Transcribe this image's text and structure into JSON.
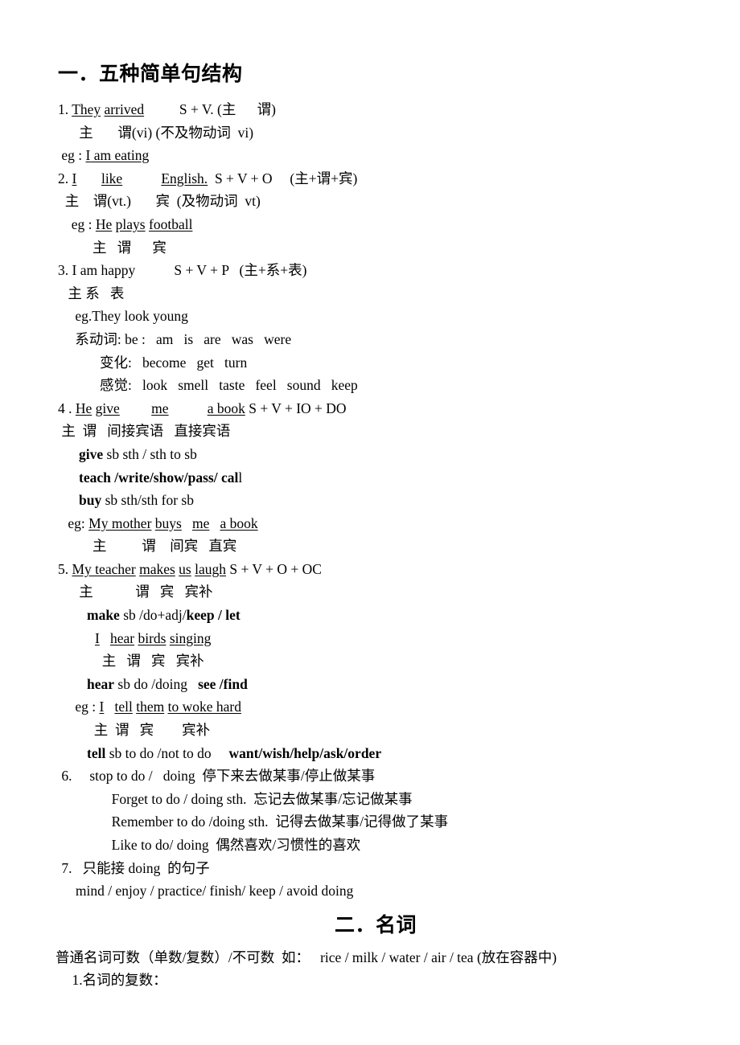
{
  "document": {
    "section1": {
      "heading": "一．五种简单句结构",
      "items": {
        "n1": {
          "num": "1. ",
          "subject": "They",
          "verb": "arrived",
          "gap1": "          ",
          "formula": "S + V. (主      谓)",
          "labels": "      主       谓(vi) (不及物动词  vi)",
          "eg_prefix": " eg : ",
          "eg_a": "I",
          "eg_b": " am eating"
        },
        "n2": {
          "num": "2. ",
          "subject": "I",
          "gap_a": "       ",
          "verb": "like",
          "gap_b": "           ",
          "object": "English.",
          "formula": "  S + V + O     (主+谓+宾)",
          "labels": "  主    谓(vt.)       宾  (及物动词  vt)",
          "eg_prefix": "  eg : ",
          "eg_a": "He",
          "eg_gap": " ",
          "eg_b": "plays",
          "eg_gap2": " ",
          "eg_c": "football",
          "eg_labels": "        主   谓      宾"
        },
        "n3": {
          "line1": "3. I am happy           S + V + P   (主+系+表)",
          "line2": " 主 系   表",
          "line3": " eg.They look young",
          "line4": " 系动词: be :   am   is   are   was   were",
          "line5": "        变化:   become   get   turn",
          "line6": "        感觉:   look   smell   taste   feel   sound   keep"
        },
        "n4": {
          "num": "4 . ",
          "subject": "He",
          "gap_a": " ",
          "verb": "give",
          "gap_b": "         ",
          "io": "me",
          "gap_c": "           ",
          "do": "a book",
          "formula": " S + V + IO + DO",
          "labels": " 主  谓   间接宾语   直接宾语",
          "v1_bold": "give",
          "v1_rest": " sb sth / sth to sb",
          "v2_bold": "teach /write/show/pass/ cal",
          "v2_rest": "l",
          "v3_bold": "buy",
          "v3_rest": " sb sth/sth for sb",
          "eg_prefix": " eg: ",
          "eg_a": "My mother",
          "eg_gap": " ",
          "eg_b": "buys",
          "eg_gap2": "   ",
          "eg_c": "me",
          "eg_gap3": "   ",
          "eg_d": "a book",
          "eg_labels": "        主          谓    间宾   直宾"
        },
        "n5": {
          "num": "5. ",
          "subject": "My teacher",
          "gap_a": " ",
          "verb": "makes",
          "gap_b": " ",
          "object": "us",
          "gap_c": " ",
          "oc": "laugh",
          "formula": " S + V + O + OC",
          "labels": "      主            谓   宾   宾补",
          "m1_b1": "make",
          "m1_r1": " sb /do+adj/",
          "m1_b2": "keep / let",
          "ex_a": "I",
          "ex_gap": "   ",
          "ex_b": "hear",
          "ex_gap2": " ",
          "ex_c": "birds",
          "ex_gap3": " ",
          "ex_d": "singing",
          "ex_labels": "  主   谓   宾   宾补",
          "h_b1": "hear",
          "h_r1": " sb do /doing   ",
          "h_b2": "see /find",
          "eg_prefix": " eg : ",
          "eg_a": "I",
          "eg_gap": "   ",
          "eg_b": "tell",
          "eg_gap2": " ",
          "eg_c": "them",
          "eg_gap3": " ",
          "eg_d": "to woke hard",
          "eg_labels": "  主  谓   宾        宾补",
          "t_b1": "tell",
          "t_r1": " sb to do /not to do     ",
          "t_b2": "want/wish/help/ask/order"
        },
        "n6": {
          "line1": " 6.     stop to do /   doing  停下来去做某事/停止做某事",
          "line2": "       Forget to do / doing sth.  忘记去做某事/忘记做某事",
          "line3": "       Remember to do /doing sth.  记得去做某事/记得做了某事",
          "line4": "       Like to do/ doing  偶然喜欢/习惯性的喜欢"
        },
        "n7": {
          "line1": " 7.   只能接 doing  的句子",
          "line2": "     mind / enjoy / practice/ finish/ keep / avoid doing"
        }
      }
    },
    "section2": {
      "heading": "二．名词",
      "line1": "普通名词可数（单数/复数）/不可数  如：   rice / milk / water / air / tea (放在容器中)",
      "line2": "    1.名词的复数："
    }
  }
}
